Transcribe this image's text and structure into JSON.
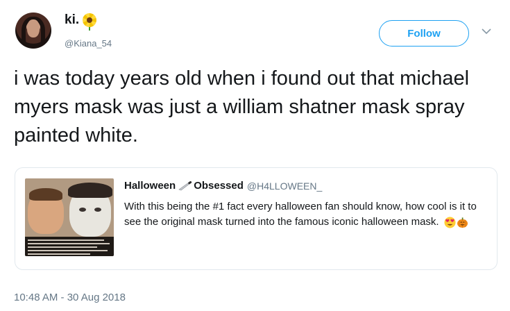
{
  "tweet": {
    "display_name": "ki.",
    "handle": "@Kiana_54",
    "follow_label": "Follow",
    "text": "i was today years old when i found out that michael myers mask was just a william shatner mask spray painted white.",
    "timestamp": "10:48 AM - 30 Aug 2018"
  },
  "quoted_tweet": {
    "name_part1": "Halloween",
    "name_part2": "Obsessed",
    "handle": "@H4LLOWEEN_",
    "text": "With this being the #1 fact every halloween fan should know, how cool is it to see the original mask turned into the famous iconic halloween mask."
  },
  "icons": {
    "name_emoji": "sunflower-icon",
    "name_separator": "knife-icon",
    "text_emojis": [
      "heart-eyes-icon",
      "pumpkin-icon"
    ],
    "menu": "chevron-down-icon"
  },
  "colors": {
    "accent": "#1da1f2",
    "secondary_text": "#657786",
    "border": "#e1e8ed"
  }
}
